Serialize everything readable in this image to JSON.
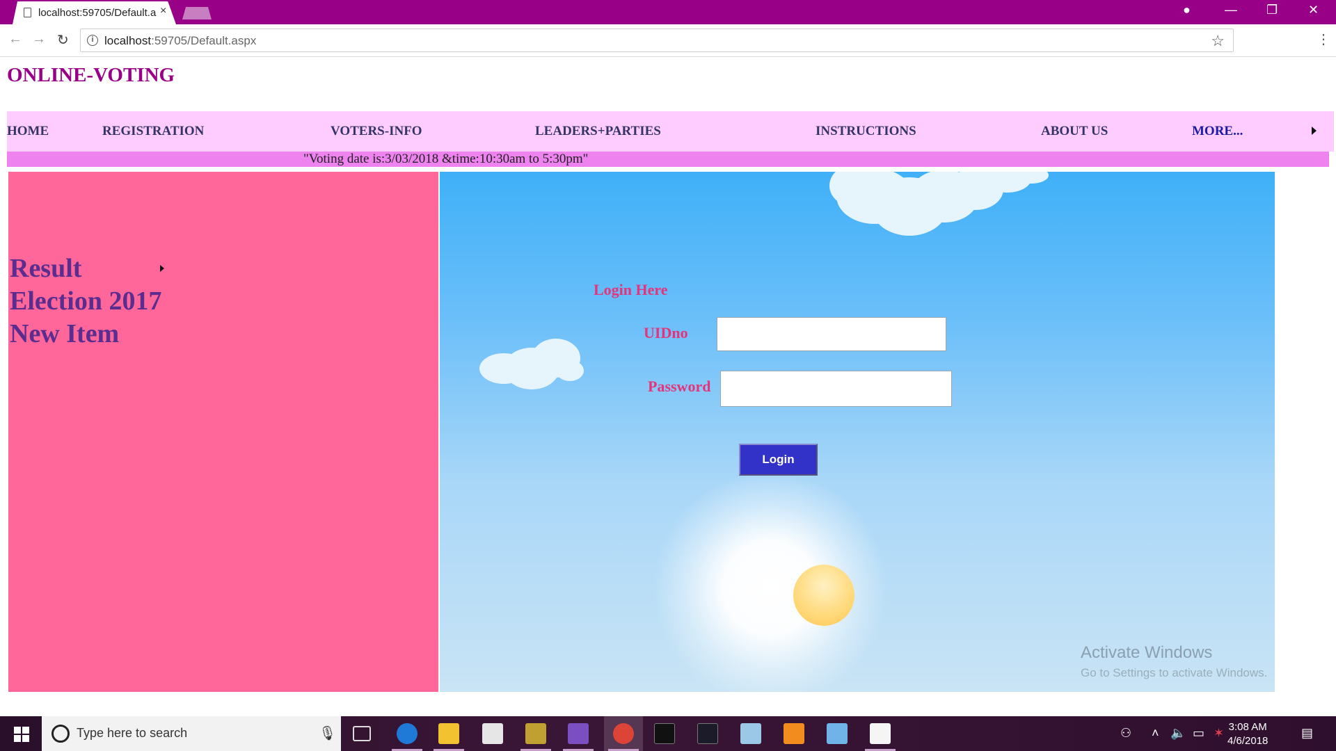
{
  "browser": {
    "tab_title": "localhost:59705/Default.aspx",
    "tab_close": "×",
    "url_host": "localhost",
    "url_rest": ":59705/Default.aspx",
    "url_info": "i",
    "back": "←",
    "forward": "→",
    "reload": "↻",
    "star": "☆",
    "menu": "⋮",
    "window_controls": {
      "profile": "●",
      "minimize": "—",
      "restore": "❐",
      "close": "✕"
    }
  },
  "site": {
    "title": "ONLINE-VOTING",
    "nav": [
      "HOME",
      "REGISTRATION",
      "VOTERS-INFO",
      "LEADERS+PARTIES",
      "INSTRUCTIONS",
      "ABOUT US",
      "MORE..."
    ],
    "marquee": "\"Voting date is:3/03/2018 &time:10:30am to 5:30pm\""
  },
  "sidebar": {
    "items": [
      "Result",
      "Election 2017",
      "New Item"
    ]
  },
  "login": {
    "heading": "Login Here",
    "uid_label": "UIDno",
    "uid_value": "",
    "password_label": "Password",
    "password_value": "",
    "button": "Login"
  },
  "watermark": {
    "title": "Activate Windows",
    "subtitle": "Go to Settings to activate Windows."
  },
  "taskbar": {
    "search_placeholder": "Type here to search",
    "time": "3:08 AM",
    "date": "4/6/2018"
  },
  "colors": {
    "chrome": "#990088",
    "navbar": "#ffccff",
    "marquee_bar": "#ee82ee",
    "sidebar": "#ff6699",
    "login_text": "#e6337a",
    "login_button": "#3232c8"
  }
}
